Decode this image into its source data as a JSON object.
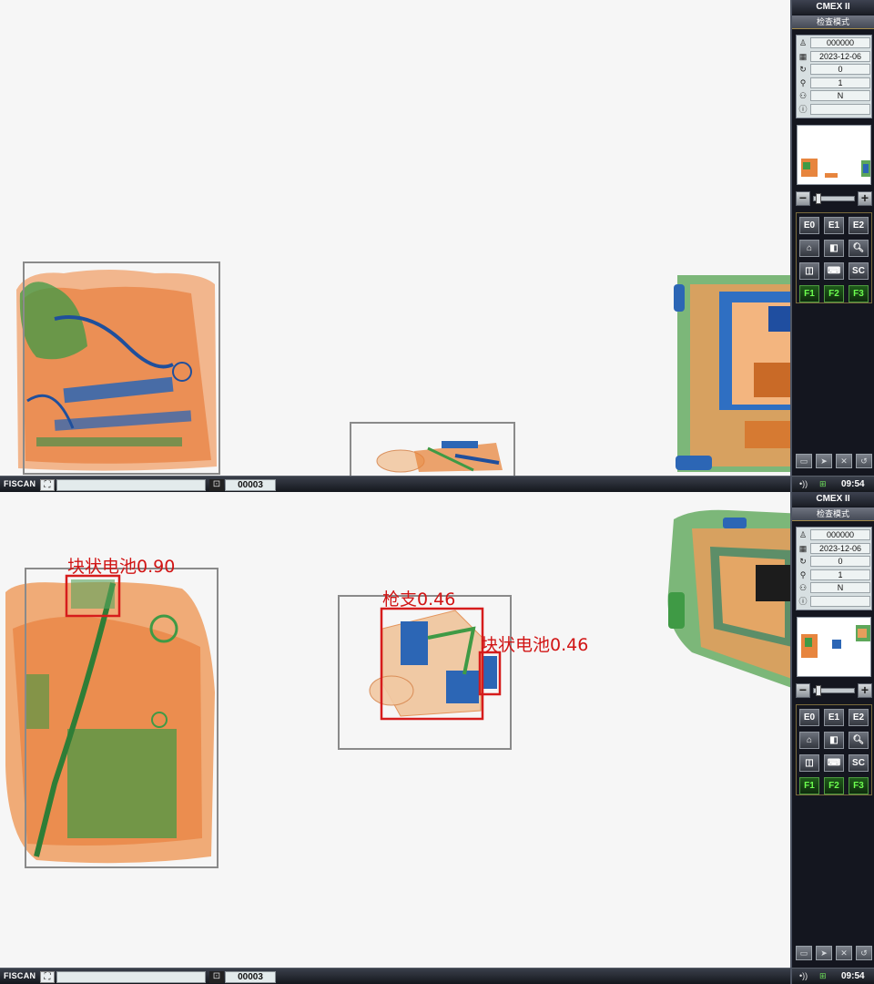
{
  "app": {
    "title": "CMEX II",
    "mode": "检查模式"
  },
  "statusbar": {
    "brand": "FISCAN",
    "bag_count": "00003"
  },
  "info": {
    "operator_id": "000000",
    "date": "2023-12-06",
    "counter": "0",
    "zoom": "1",
    "flag": "N",
    "note": ""
  },
  "buttons": [
    {
      "id": "e0",
      "label": "E0"
    },
    {
      "id": "e1",
      "label": "E1"
    },
    {
      "id": "e2",
      "label": "E2"
    },
    {
      "id": "home",
      "label": "⌂"
    },
    {
      "id": "material",
      "label": "◧"
    },
    {
      "id": "magnify",
      "label": "🔍︎"
    },
    {
      "id": "split",
      "label": "◫"
    },
    {
      "id": "keyboard",
      "label": "⌨"
    },
    {
      "id": "sc",
      "label": "SC"
    },
    {
      "id": "f1",
      "label": "F1"
    },
    {
      "id": "f2",
      "label": "F2"
    },
    {
      "id": "f3",
      "label": "F3"
    }
  ],
  "clock": "09:54",
  "detections": [
    {
      "label": "块状电池0.90"
    },
    {
      "label": "枪支0.46"
    },
    {
      "label": "块状电池0.46"
    }
  ],
  "colors": {
    "organic": "#e8782c",
    "mixed": "#3fa547",
    "metal": "#2667b8",
    "detection_box": "#d61c1c",
    "object_box": "#8a8a8a"
  }
}
